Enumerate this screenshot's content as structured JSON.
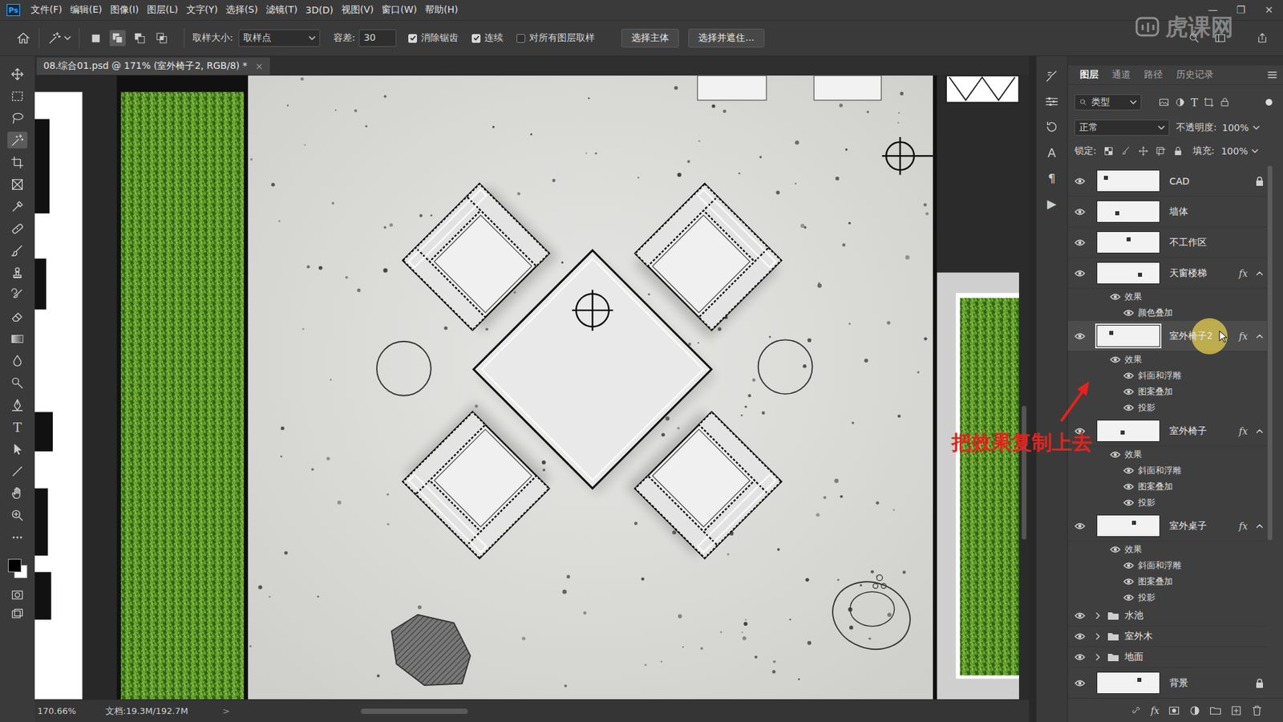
{
  "app": {
    "logo": "Ps",
    "menu": [
      "文件(F)",
      "编辑(E)",
      "图像(I)",
      "图层(L)",
      "文字(Y)",
      "选择(S)",
      "滤镜(T)",
      "3D(D)",
      "视图(V)",
      "窗口(W)",
      "帮助(H)"
    ],
    "window_controls": [
      "—",
      "❐",
      "✕"
    ],
    "watermark": "虎课网"
  },
  "options": {
    "selection_modes": [
      {
        "selected": false
      },
      {
        "selected": true
      },
      {
        "selected": false
      },
      {
        "selected": false
      }
    ],
    "sample_size_label": "取样大小:",
    "sample_size": "取样点",
    "tolerance_label": "容差:",
    "tolerance": "30",
    "checkboxes": [
      {
        "label": "消除锯齿",
        "checked": true
      },
      {
        "label": "连续",
        "checked": true
      },
      {
        "label": "对所有图层取样",
        "checked": false
      }
    ],
    "buttons": [
      "选择主体",
      "选择并遮住..."
    ]
  },
  "tools": [
    {
      "kind": "icon",
      "selected": false
    },
    {
      "kind": "icon",
      "selected": false
    },
    {
      "kind": "icon",
      "selected": false
    },
    {
      "kind": "icon",
      "selected": true
    },
    {
      "kind": "icon",
      "selected": false
    },
    {
      "kind": "icon",
      "selected": false
    },
    {
      "kind": "icon",
      "selected": false
    },
    {
      "kind": "icon",
      "selected": false
    },
    {
      "kind": "icon",
      "selected": false
    },
    {
      "kind": "icon",
      "selected": false
    },
    {
      "kind": "icon",
      "selected": false
    },
    {
      "kind": "icon",
      "selected": false
    },
    {
      "kind": "icon",
      "selected": false
    },
    {
      "kind": "icon",
      "selected": false
    },
    {
      "kind": "icon",
      "selected": false
    },
    {
      "kind": "icon",
      "selected": false
    },
    {
      "kind": "glyph",
      "text": "T",
      "selected": false
    },
    {
      "kind": "icon",
      "selected": false
    },
    {
      "kind": "icon",
      "selected": false
    },
    {
      "kind": "icon",
      "selected": false
    },
    {
      "kind": "icon",
      "selected": false
    },
    {
      "kind": "icon",
      "selected": false
    }
  ],
  "document_tab": {
    "title": "08.综合01.psd @ 171% (室外椅子2, RGB/8) *",
    "close": "×"
  },
  "status_bar": {
    "zoom": "170.66%",
    "doc": "文档:19.3M/192.7M",
    "arrow": ">"
  },
  "side_strip": {
    "glyphs": [
      "A",
      "¶",
      "▶"
    ]
  },
  "layers_panel": {
    "tabs": [
      {
        "label": "图层",
        "selected": true
      },
      {
        "label": "通道",
        "selected": false
      },
      {
        "label": "路径",
        "selected": false
      },
      {
        "label": "历史记录",
        "selected": false
      }
    ],
    "filter": "类型",
    "filter_glyph": "T",
    "blend": "正常",
    "opacity_label": "不透明度:",
    "opacity": "100%",
    "lock_label": "锁定:",
    "fill_label": "填充:",
    "fill": "100%",
    "layers": [
      {
        "kind": "layer",
        "name": "CAD",
        "visible": true,
        "selected": false,
        "locked": true
      },
      {
        "kind": "layer",
        "name": "墙体",
        "visible": true,
        "selected": false,
        "locked": false
      },
      {
        "kind": "layer",
        "name": "不工作区",
        "visible": true,
        "selected": false,
        "locked": false
      },
      {
        "kind": "layer",
        "name": "天窗楼梯",
        "visible": true,
        "selected": false,
        "locked": false,
        "fx": "fx",
        "expanded": true,
        "effects_header": "效果",
        "effects_visible": true,
        "effects": [
          {
            "name": "颜色叠加",
            "visible": true
          }
        ]
      },
      {
        "kind": "layer",
        "name": "室外椅子2",
        "visible": true,
        "selected": true,
        "locked": false,
        "fx": "fx",
        "expanded": true,
        "effects_header": "效果",
        "effects_visible": true,
        "effects": [
          {
            "name": "斜面和浮雕",
            "visible": true
          },
          {
            "name": "图案叠加",
            "visible": true
          },
          {
            "name": "投影",
            "visible": true
          }
        ]
      },
      {
        "kind": "layer",
        "name": "室外椅子",
        "visible": true,
        "selected": false,
        "locked": false,
        "fx": "fx",
        "expanded": true,
        "effects_header": "效果",
        "effects_visible": true,
        "effects": [
          {
            "name": "斜面和浮雕",
            "visible": true
          },
          {
            "name": "图案叠加",
            "visible": true
          },
          {
            "name": "投影",
            "visible": true
          }
        ]
      },
      {
        "kind": "layer",
        "name": "室外桌子",
        "visible": true,
        "selected": false,
        "locked": false,
        "fx": "fx",
        "expanded": true,
        "effects_header": "效果",
        "effects_visible": true,
        "effects": [
          {
            "name": "斜面和浮雕",
            "visible": true
          },
          {
            "name": "图案叠加",
            "visible": true
          },
          {
            "name": "投影",
            "visible": true
          }
        ]
      },
      {
        "kind": "group",
        "name": "水池",
        "visible": true,
        "selected": false,
        "expanded": false
      },
      {
        "kind": "group",
        "name": "室外木",
        "visible": true,
        "selected": false,
        "expanded": false
      },
      {
        "kind": "group",
        "name": "地面",
        "visible": true,
        "selected": false,
        "expanded": false
      },
      {
        "kind": "layer",
        "name": "背景",
        "visible": true,
        "selected": false,
        "locked": true
      }
    ],
    "footer_glyph": "fx"
  },
  "annotation": {
    "text": "把效果复制上去"
  }
}
